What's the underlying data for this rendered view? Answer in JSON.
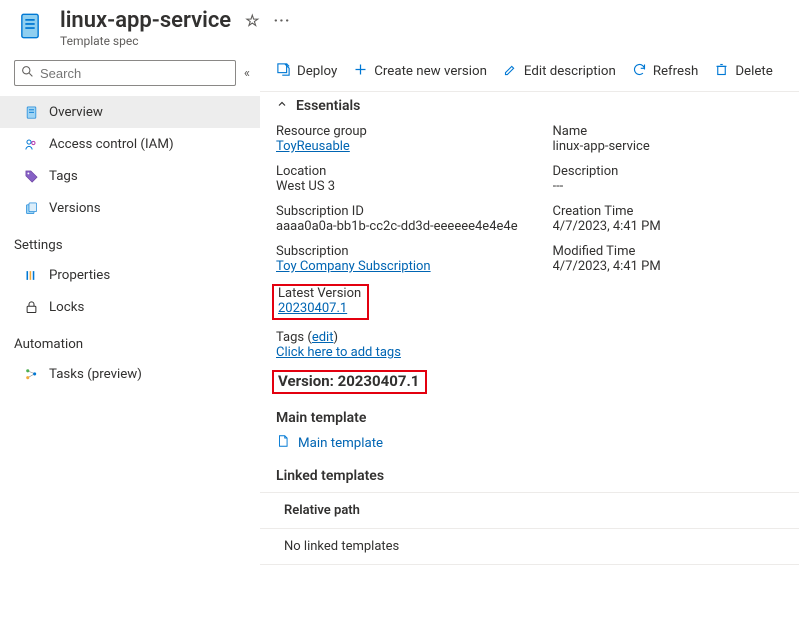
{
  "header": {
    "title": "linux-app-service",
    "subtitle": "Template spec"
  },
  "search": {
    "placeholder": "Search"
  },
  "sidebar": {
    "items": [
      {
        "label": "Overview"
      },
      {
        "label": "Access control (IAM)"
      },
      {
        "label": "Tags"
      },
      {
        "label": "Versions"
      }
    ],
    "group_settings": "Settings",
    "settings_items": [
      {
        "label": "Properties"
      },
      {
        "label": "Locks"
      }
    ],
    "group_automation": "Automation",
    "automation_items": [
      {
        "label": "Tasks (preview)"
      }
    ]
  },
  "toolbar": {
    "deploy": "Deploy",
    "create": "Create new version",
    "edit": "Edit description",
    "refresh": "Refresh",
    "delete": "Delete"
  },
  "essentials": {
    "heading": "Essentials",
    "left": {
      "resource_group_label": "Resource group",
      "resource_group": "ToyReusable",
      "location_label": "Location",
      "location": "West US 3",
      "subid_label": "Subscription ID",
      "subid": "aaaa0a0a-bb1b-cc2c-dd3d-eeeeee4e4e4e",
      "sub_label": "Subscription",
      "sub": "Toy Company Subscription",
      "latest_label": "Latest Version",
      "latest": "20230407.1",
      "tags_label": "Tags",
      "tags_edit": "edit",
      "tags_link": "Click here to add tags"
    },
    "right": {
      "name_label": "Name",
      "name": "linux-app-service",
      "desc_label": "Description",
      "desc": "---",
      "created_label": "Creation Time",
      "created": "4/7/2023, 4:41 PM",
      "modified_label": "Modified Time",
      "modified": "4/7/2023, 4:41 PM"
    }
  },
  "version": {
    "label": "Version",
    "value": "20230407.1"
  },
  "main_template": {
    "heading": "Main template",
    "link": "Main template"
  },
  "linked": {
    "heading": "Linked templates",
    "col": "Relative path",
    "empty": "No linked templates"
  }
}
